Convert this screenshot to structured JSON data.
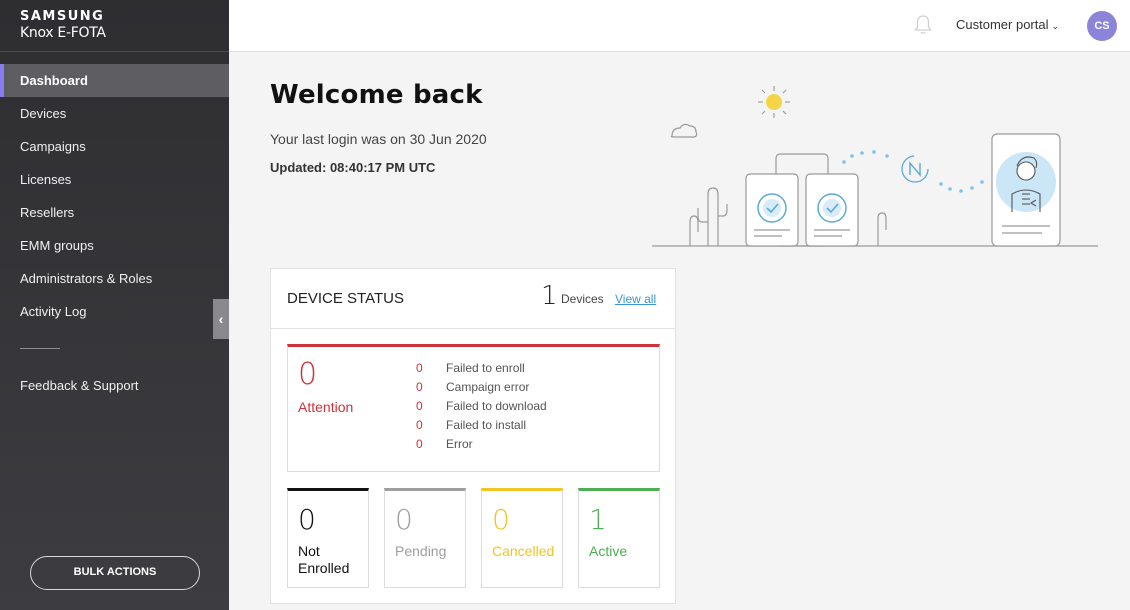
{
  "brand": {
    "line1": "SAMSUNG",
    "line2": "Knox E-FOTA"
  },
  "sidebar": {
    "items": [
      {
        "label": "Dashboard",
        "active": true
      },
      {
        "label": "Devices"
      },
      {
        "label": "Campaigns"
      },
      {
        "label": "Licenses"
      },
      {
        "label": "Resellers"
      },
      {
        "label": "EMM groups"
      },
      {
        "label": "Administrators & Roles"
      },
      {
        "label": "Activity Log"
      }
    ],
    "feedback_label": "Feedback & Support",
    "bulk_actions_label": "BULK ACTIONS",
    "collapse_glyph": "‹"
  },
  "topbar": {
    "bell_icon": "bell-icon",
    "portal_label": "Customer portal",
    "portal_chevron": "⌄",
    "avatar_initials": "CS",
    "avatar_color": "#8b84d9"
  },
  "main": {
    "welcome": "Welcome back",
    "last_login": "Your last login was on 30 Jun 2020",
    "updated": "Updated: 08:40:17 PM UTC"
  },
  "device_status": {
    "title": "DEVICE STATUS",
    "device_count": "1",
    "devices_label": "Devices",
    "view_all": "View all",
    "attention": {
      "count": "0",
      "label": "Attention",
      "color": "#d13239",
      "rows": [
        {
          "count": "0",
          "label": "Failed to enroll"
        },
        {
          "count": "0",
          "label": "Campaign error"
        },
        {
          "count": "0",
          "label": "Failed to download"
        },
        {
          "count": "0",
          "label": "Failed to install"
        },
        {
          "count": "0",
          "label": "Error"
        }
      ]
    },
    "tiles": [
      {
        "count": "0",
        "label": "Not Enrolled",
        "color": "#111111"
      },
      {
        "count": "0",
        "label": "Pending",
        "color": "#9e9e9e"
      },
      {
        "count": "0",
        "label": "Cancelled",
        "color": "#f2c425"
      },
      {
        "count": "1",
        "label": "Active",
        "color": "#4caf50"
      }
    ]
  }
}
